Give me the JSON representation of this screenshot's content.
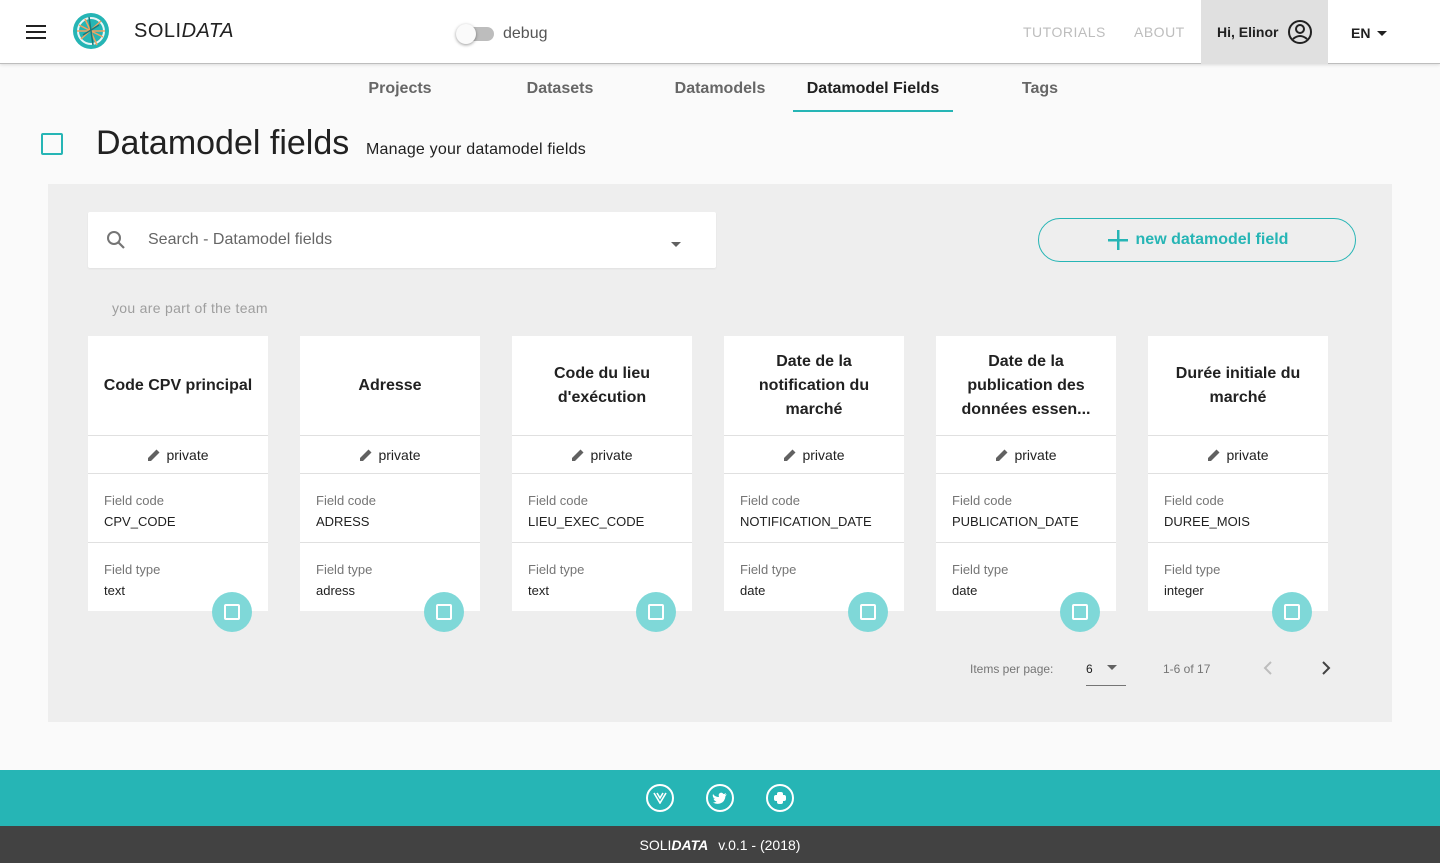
{
  "app": {
    "brand_prefix": "SOLI",
    "brand_suffix": "DATA",
    "debug_label": "debug"
  },
  "nav": {
    "tutorials": "TUTORIALS",
    "about": "ABOUT",
    "user_greeting": "Hi, Elinor",
    "language": "EN"
  },
  "tabs": [
    {
      "label": "Projects"
    },
    {
      "label": "Datasets"
    },
    {
      "label": "Datamodels"
    },
    {
      "label": "Datamodel Fields",
      "active": true
    },
    {
      "label": "Tags"
    }
  ],
  "page": {
    "title": "Datamodel fields",
    "subtitle": "Manage your datamodel fields"
  },
  "search": {
    "placeholder": "Search - Datamodel fields"
  },
  "new_button_label": "new datamodel field",
  "team_note": "you are part of the team",
  "cards": [
    {
      "title": "Code CPV principal",
      "visibility": "private",
      "field_code_label": "Field code",
      "field_code": "CPV_CODE",
      "field_type_label": "Field type",
      "field_type": "text"
    },
    {
      "title": "Adresse",
      "visibility": "private",
      "field_code_label": "Field code",
      "field_code": "ADRESS",
      "field_type_label": "Field type",
      "field_type": "adress"
    },
    {
      "title": "Code du lieu d'exécution",
      "visibility": "private",
      "field_code_label": "Field code",
      "field_code": "LIEU_EXEC_CODE",
      "field_type_label": "Field type",
      "field_type": "text"
    },
    {
      "title": "Date de la notification du marché",
      "visibility": "private",
      "field_code_label": "Field code",
      "field_code": "NOTIFICATION_DATE",
      "field_type_label": "Field type",
      "field_type": "date"
    },
    {
      "title": "Date de la publication des données essen...",
      "visibility": "private",
      "field_code_label": "Field code",
      "field_code": "PUBLICATION_DATE",
      "field_type_label": "Field type",
      "field_type": "date"
    },
    {
      "title": "Durée initiale du marché",
      "visibility": "private",
      "field_code_label": "Field code",
      "field_code": "DUREE_MOIS",
      "field_type_label": "Field type",
      "field_type": "integer"
    }
  ],
  "pagination": {
    "items_per_page_label": "Items per page:",
    "items_per_page": "6",
    "range": "1-6 of 17"
  },
  "footer": {
    "brand_prefix": "SOLI",
    "brand_suffix": "DATA",
    "version": "v.0.1 - (2018)",
    "icons": [
      "vue-icon",
      "twitter-icon",
      "python-icon"
    ]
  },
  "colors": {
    "accent": "#26b5b5",
    "fab": "#7fd8d8",
    "footer_dark": "#424242"
  }
}
